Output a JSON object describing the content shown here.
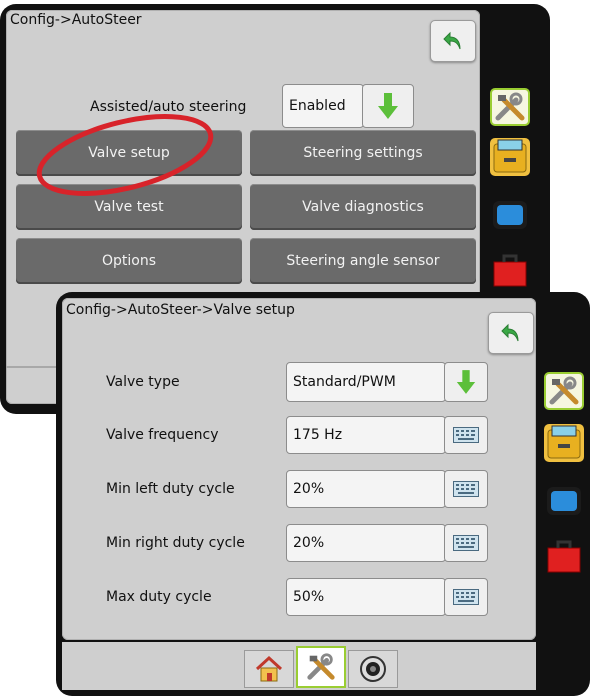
{
  "back_screen": {
    "breadcrumb": "Config->AutoSteer",
    "assisted_label": "Assisted/auto steering",
    "assisted_value": "Enabled",
    "buttons": [
      "Valve setup",
      "Steering settings",
      "Valve test",
      "Valve diagnostics",
      "Options",
      "Steering angle sensor"
    ]
  },
  "front_screen": {
    "breadcrumb": "Config->AutoSteer->Valve setup",
    "rows": [
      {
        "label": "Valve type",
        "value": "Standard/PWM",
        "control": "dropdown"
      },
      {
        "label": "Valve frequency",
        "value": "175 Hz",
        "control": "keyboard"
      },
      {
        "label": "Min left duty cycle",
        "value": "20%",
        "control": "keyboard"
      },
      {
        "label": "Min right duty cycle",
        "value": "20%",
        "control": "keyboard"
      },
      {
        "label": "Max duty cycle",
        "value": "50%",
        "control": "keyboard"
      }
    ]
  },
  "sidebar_icons": [
    "tools-icon",
    "console-icon",
    "display-icon",
    "toolbox-icon"
  ],
  "nav_icons": [
    "home-icon",
    "tools-icon",
    "camera-icon"
  ],
  "colors": {
    "accent_green": "#9acd32",
    "annotation_red": "#d8232a",
    "button_gray": "#6a6a6a"
  }
}
